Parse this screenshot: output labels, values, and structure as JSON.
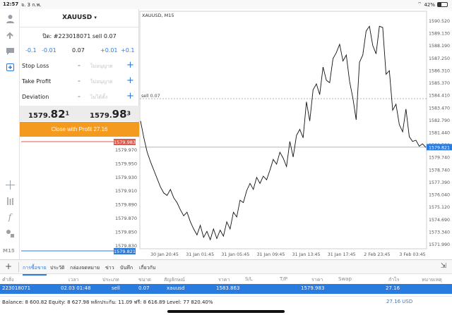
{
  "status": {
    "time": "12:57",
    "date": "จ. 3 ก.พ.",
    "battery": "42%",
    "battery_level": 0.42
  },
  "rail": {
    "icons": [
      "user-icon",
      "trade-icon",
      "chat-icon",
      "new-order-icon",
      "crosshair-icon",
      "indicator-icon",
      "function-icon",
      "objects-icon"
    ],
    "timeframe": "M15"
  },
  "order": {
    "symbol": "XAUUSD",
    "symbol_caret": "▾",
    "ticket_line": "ปิด: #223018071 sell 0.07",
    "minus_large": "-0.1",
    "minus_small": "-0.01",
    "volume": "0.07",
    "plus_small": "+0.01",
    "plus_large": "+0.1",
    "stop_loss": {
      "label": "Stop Loss",
      "placeholder": "ไม่อนุญาต"
    },
    "take_profit": {
      "label": "Take Profit",
      "placeholder": "ไม่อนุญาต"
    },
    "deviation": {
      "label": "Deviation",
      "placeholder": "ไม่ได้ตั้ง"
    },
    "bid": {
      "small": "1579.",
      "big": "82",
      "sup": "1"
    },
    "ask": {
      "small": "1579.",
      "big": "98",
      "sup": "3"
    },
    "close_button": "Close with Profit 27.16"
  },
  "colors": {
    "accent": "#2a7be0",
    "close_btn": "#f39a1f",
    "ask_line": "#e05a4a"
  },
  "chart_data": {
    "type": "line",
    "title": "XAUUSD, M15",
    "x_labels": [
      "30 Jan 20:45",
      "31 Jan 01:45",
      "31 Jan 05:45",
      "31 Jan 09:45",
      "31 Jan 13:45",
      "31 Jan 17:45",
      "2 Feb 23:45",
      "3 Feb 03:45"
    ],
    "y_ticks": [
      "1590.520",
      "1589.130",
      "1588.190",
      "1587.250",
      "1586.310",
      "1585.370",
      "1584.410",
      "1583.470",
      "1582.790",
      "1581.440",
      "1580.590",
      "1579.740",
      "1578.740",
      "1577.390",
      "1576.040",
      "1575.120",
      "1574.690",
      "1573.340",
      "1571.990"
    ],
    "ylim": [
      1571.35,
      1591.15
    ],
    "current_price": "1579.821",
    "order_label": "sell 0.07",
    "order_price": 1583.863,
    "values": [
      1582.0,
      1580.6,
      1579.4,
      1578.6,
      1577.9,
      1577.2,
      1576.5,
      1576.0,
      1575.8,
      1576.3,
      1575.6,
      1575.2,
      1574.6,
      1574.1,
      1574.4,
      1573.6,
      1573.0,
      1572.5,
      1573.3,
      1572.3,
      1572.8,
      1572.1,
      1573.0,
      1572.2,
      1572.9,
      1572.4,
      1573.6,
      1573.0,
      1574.4,
      1574.0,
      1575.4,
      1575.2,
      1576.2,
      1576.8,
      1576.3,
      1577.3,
      1576.8,
      1577.4,
      1577.1,
      1577.9,
      1578.8,
      1578.4,
      1579.4,
      1578.9,
      1578.2,
      1580.3,
      1579.0,
      1580.8,
      1581.3,
      1580.6,
      1583.6,
      1582.0,
      1584.6,
      1585.1,
      1584.2,
      1586.5,
      1585.4,
      1585.2,
      1587.2,
      1587.7,
      1588.4,
      1587.0,
      1587.5,
      1585.3,
      1583.9,
      1582.1,
      1586.9,
      1587.5,
      1589.5,
      1589.9,
      1588.3,
      1587.6,
      1589.9,
      1589.8,
      1585.9,
      1586.2,
      1582.9,
      1583.4,
      1581.7,
      1581.1,
      1583.0,
      1580.7,
      1580.3,
      1580.4,
      1579.9,
      1580.1,
      1579.8
    ]
  },
  "panel_chart": {
    "ask_label": "1579.983",
    "bid_label": "1579.821",
    "y_ticks": [
      "1579.970",
      "1579.950",
      "1579.930",
      "1579.910",
      "1579.890",
      "1579.870",
      "1579.850",
      "1579.830"
    ]
  },
  "tabs": [
    "การซื้อขาย",
    "ประวัติ",
    "กล่องจดหมาย",
    "ข่าว",
    "บันทึก",
    "เกี่ยวกับ"
  ],
  "positions": {
    "headers": [
      "คำสั่ง",
      "เวลา",
      "ประเภท",
      "ขนาด",
      "สัญลักษณ์",
      "ราคา",
      "S/L",
      "T/P",
      "ราคา",
      "Swap",
      "กำไร",
      "หมายเหตุ"
    ],
    "row": [
      "223018071",
      "02.03 01:48",
      "sell",
      "0.07",
      "xauusd",
      "1583.863",
      "",
      "",
      "1579.983",
      "",
      "27.16",
      ""
    ]
  },
  "summary": {
    "balance": "Balance: 8 600.82 Equity: 8 627.98 หลักประกัน: 11.09 ฟรี: 8 616.89 Level: 77 820.40%",
    "profit": "27.16  USD"
  }
}
